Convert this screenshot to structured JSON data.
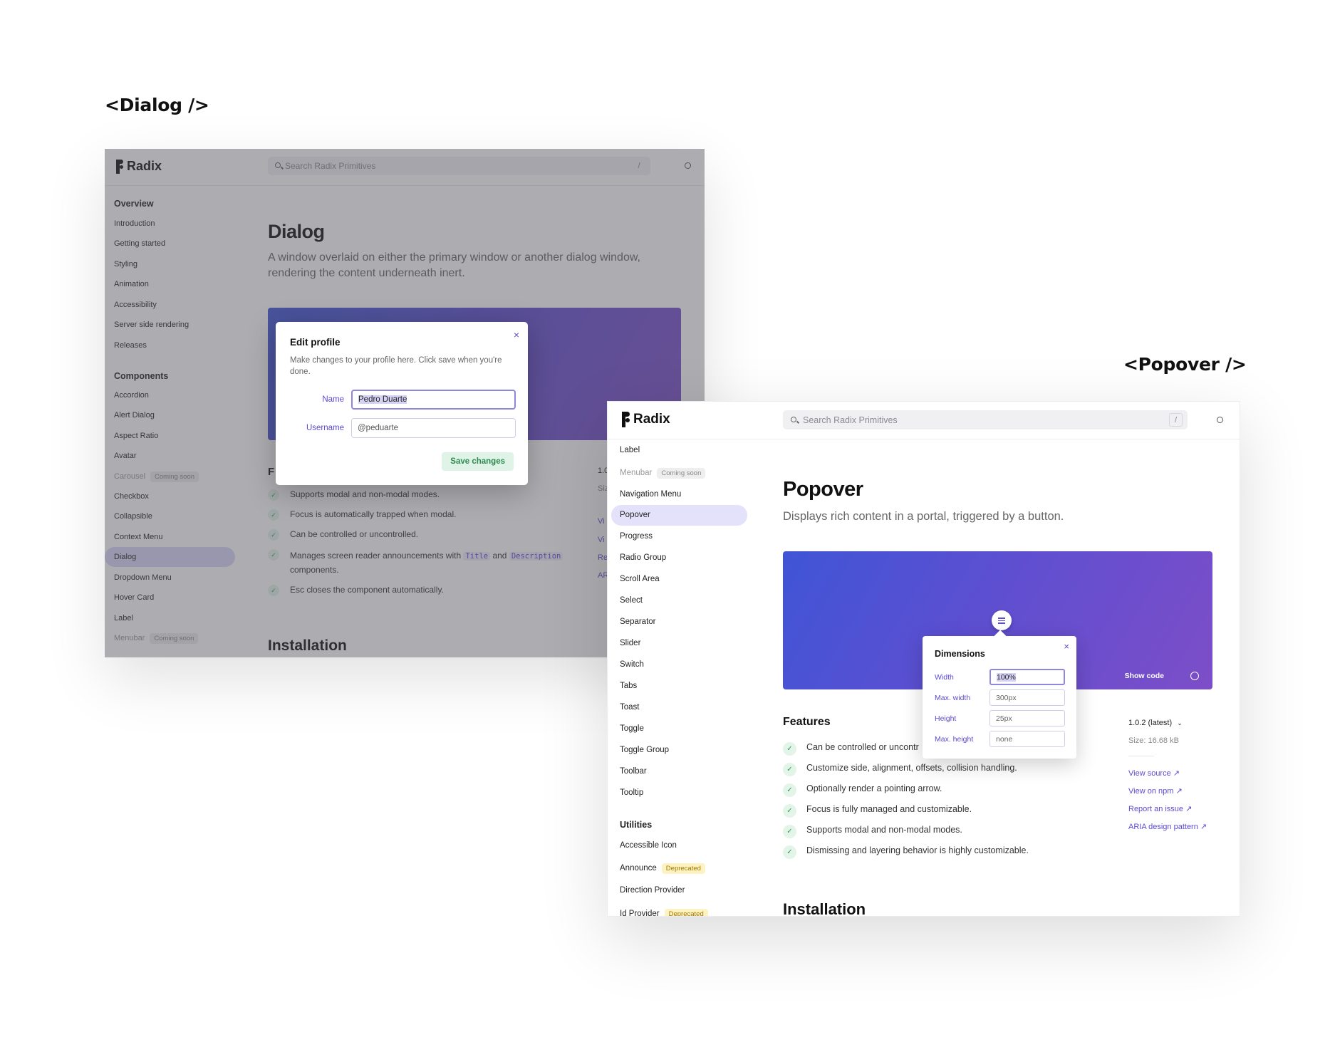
{
  "headings": {
    "dialog": "<Dialog />",
    "popover": "<Popover />"
  },
  "dialog_window": {
    "logo": "Radix",
    "search_placeholder": "Search Radix Primitives",
    "search_shortcut": "/",
    "sidebar": {
      "overview_title": "Overview",
      "overview_items": [
        "Introduction",
        "Getting started",
        "Styling",
        "Animation",
        "Accessibility",
        "Server side rendering",
        "Releases"
      ],
      "components_title": "Components",
      "components_items": [
        {
          "label": "Accordion"
        },
        {
          "label": "Alert Dialog"
        },
        {
          "label": "Aspect Ratio"
        },
        {
          "label": "Avatar"
        },
        {
          "label": "Carousel",
          "badge": "Coming soon"
        },
        {
          "label": "Checkbox"
        },
        {
          "label": "Collapsible"
        },
        {
          "label": "Context Menu"
        },
        {
          "label": "Dialog",
          "active": true
        },
        {
          "label": "Dropdown Menu"
        },
        {
          "label": "Hover Card"
        },
        {
          "label": "Label"
        },
        {
          "label": "Menubar",
          "badge": "Coming soon"
        }
      ]
    },
    "title": "Dialog",
    "description": "A window overlaid on either the primary window or another dialog window, rendering the content underneath inert.",
    "features_heading_partial": "F",
    "version_partial": "1.0",
    "size_partial": "Siz",
    "link_partials": [
      "Vi",
      "Vi",
      "Re",
      "AR"
    ],
    "features": [
      "Supports modal and non-modal modes.",
      "Focus is automatically trapped when modal.",
      "Can be controlled or uncontrolled."
    ],
    "feature_sr": {
      "before": "Manages screen reader announcements with",
      "code1": "Title",
      "and": "and",
      "code2": "Description",
      "after": "components."
    },
    "feature_esc": "Esc closes the component automatically.",
    "installation": "Installation",
    "modal": {
      "title": "Edit profile",
      "description": "Make changes to your profile here. Click save when you're done.",
      "name_label": "Name",
      "name_value": "Pedro Duarte",
      "username_label": "Username",
      "username_value": "@peduarte",
      "save_label": "Save changes",
      "close_icon": "×"
    }
  },
  "popover_window": {
    "logo": "Radix",
    "search_placeholder": "Search Radix Primitives",
    "search_shortcut": "/",
    "sidebar": {
      "items": [
        {
          "label": "Label"
        },
        {
          "label": "Menubar",
          "badge": "Coming soon",
          "muted": true
        },
        {
          "label": "Navigation Menu"
        },
        {
          "label": "Popover",
          "active": true
        },
        {
          "label": "Progress"
        },
        {
          "label": "Radio Group"
        },
        {
          "label": "Scroll Area"
        },
        {
          "label": "Select"
        },
        {
          "label": "Separator"
        },
        {
          "label": "Slider"
        },
        {
          "label": "Switch"
        },
        {
          "label": "Tabs"
        },
        {
          "label": "Toast"
        },
        {
          "label": "Toggle"
        },
        {
          "label": "Toggle Group"
        },
        {
          "label": "Toolbar"
        },
        {
          "label": "Tooltip"
        }
      ],
      "utilities_title": "Utilities",
      "utilities_items": [
        {
          "label": "Accessible Icon"
        },
        {
          "label": "Announce",
          "badge": "Deprecated"
        },
        {
          "label": "Direction Provider"
        },
        {
          "label": "Id Provider",
          "badge": "Deprecated"
        }
      ]
    },
    "title": "Popover",
    "description": "Displays rich content in a portal, triggered by a button.",
    "show_code": "Show code",
    "popover": {
      "title": "Dimensions",
      "close_icon": "×",
      "fields": [
        {
          "label": "Width",
          "value": "100%",
          "focused": true
        },
        {
          "label": "Max. width",
          "value": "300px"
        },
        {
          "label": "Height",
          "value": "25px"
        },
        {
          "label": "Max. height",
          "value": "none"
        }
      ]
    },
    "features_heading": "Features",
    "features": [
      "Can be controlled or uncontrolled.",
      "Customize side, alignment, offsets, collision handling.",
      "Optionally render a pointing arrow.",
      "Focus is fully managed and customizable.",
      "Supports modal and non-modal modes.",
      "Dismissing and layering behavior is highly customizable."
    ],
    "first_feature_visible": "Can be controlled or uncontr",
    "version": "1.0.2 (latest)",
    "size": "Size: 16.68 kB",
    "links": [
      "View source",
      "View on npm",
      "Report an issue",
      "ARIA design pattern"
    ],
    "installation": "Installation"
  },
  "colors": {
    "accent": "#5b4bd0",
    "hero_start": "#3f55d6",
    "hero_end": "#7d4ec8",
    "check_bg": "#e3f4e8",
    "check_fg": "#2f9a56",
    "active_nav": "#e4e1fb"
  }
}
